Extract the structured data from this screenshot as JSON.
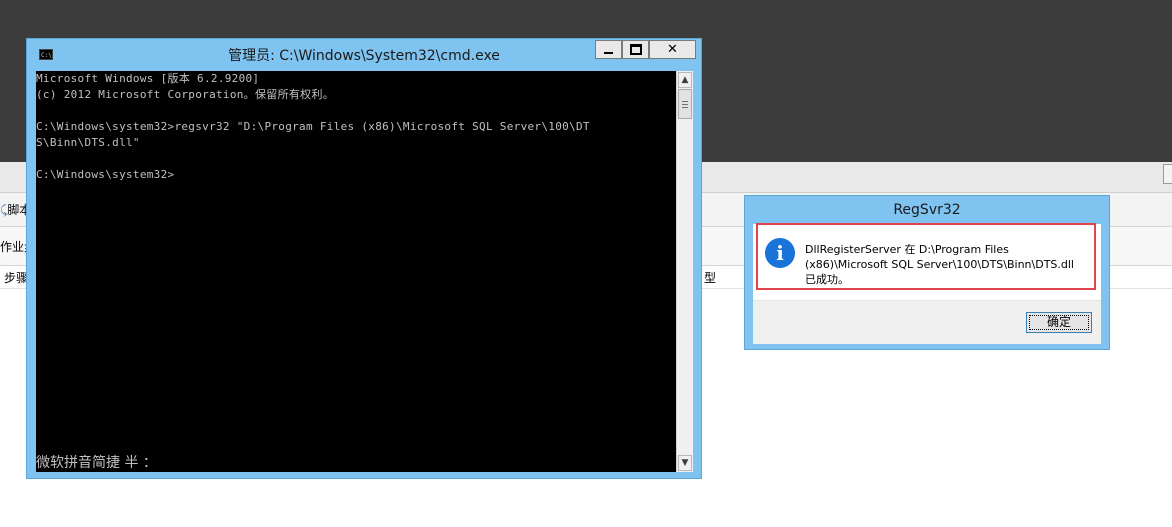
{
  "background_app": {
    "toolbar_label": "脚本",
    "tab_label": "作业步",
    "column_step": "步骤",
    "column_type": "型"
  },
  "cmd": {
    "title": "管理员: C:\\Windows\\System32\\cmd.exe",
    "lines": [
      "Microsoft Windows [版本 6.2.9200]",
      "(c) 2012 Microsoft Corporation。保留所有权利。",
      "",
      "C:\\Windows\\system32>regsvr32 \"D:\\Program Files (x86)\\Microsoft SQL Server\\100\\DT",
      "S\\Binn\\DTS.dll\"",
      "",
      "C:\\Windows\\system32>"
    ],
    "ime_status": "微软拼音简捷 半 ："
  },
  "dialog": {
    "title": "RegSvr32",
    "message_line1": "DllRegisterServer 在 D:\\Program Files",
    "message_line2": "(x86)\\Microsoft SQL Server\\100\\DTS\\Binn\\DTS.dll",
    "message_line3": "已成功。",
    "ok_label": "确定"
  },
  "colors": {
    "window_frame": "#7fc3f0",
    "console_bg": "#000000",
    "console_text": "#c0c0c0",
    "highlight": "#e0424e",
    "info_icon": "#1a73d8"
  }
}
